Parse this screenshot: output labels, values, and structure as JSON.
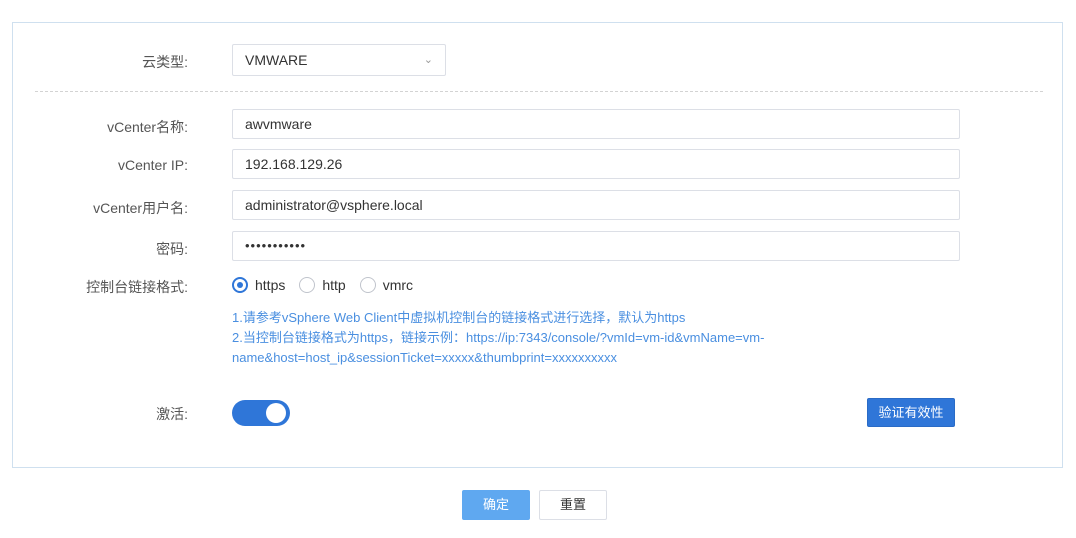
{
  "form": {
    "cloud_type": {
      "label": "云类型:",
      "value": "VMWARE"
    },
    "vcenter_name": {
      "label": "vCenter名称:",
      "value": "awvmware"
    },
    "vcenter_ip": {
      "label": "vCenter IP:",
      "value": "192.168.129.26"
    },
    "vcenter_user": {
      "label": "vCenter用户名:",
      "value": "administrator@vsphere.local"
    },
    "password": {
      "label": "密码:",
      "value": "•••••••••••"
    },
    "console_format": {
      "label": "控制台链接格式:",
      "options": [
        "https",
        "http",
        "vmrc"
      ],
      "selected": "https"
    },
    "hints": [
      "1.请参考vSphere Web Client中虚拟机控制台的链接格式进行选择，默认为https",
      "2.当控制台链接格式为https，链接示例：https://ip:7343/console/?vmId=vm-id&vmName=vm-",
      "name&host=host_ip&sessionTicket=xxxxx&thumbprint=xxxxxxxxxx"
    ],
    "activate": {
      "label": "激活:",
      "on": true
    },
    "verify_label": "验证有效性"
  },
  "footer": {
    "ok_label": "确定",
    "reset_label": "重置"
  },
  "colors": {
    "primary": "#2f76d8",
    "hint": "#4a8fe0",
    "ok_button": "#5fa8f0"
  }
}
